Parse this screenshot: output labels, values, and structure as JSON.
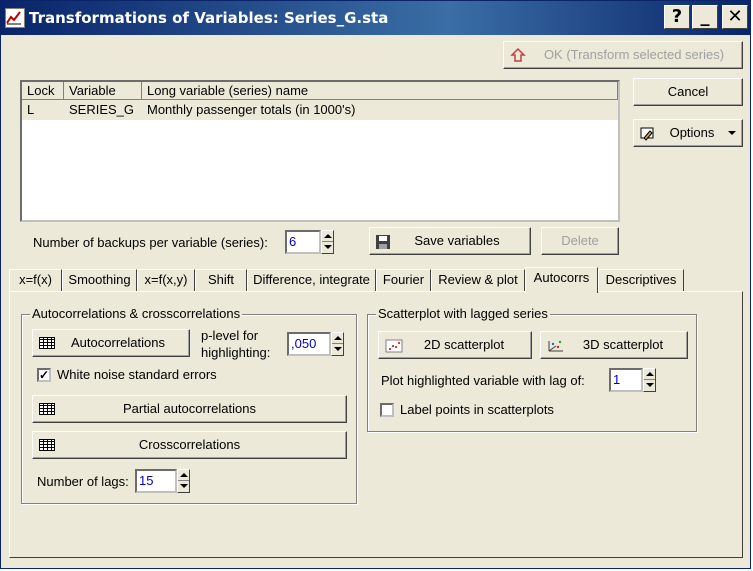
{
  "window": {
    "title": "Transformations of Variables: Series_G.sta",
    "help_glyph": "?",
    "minimize_glyph": "_",
    "close_glyph": "✕"
  },
  "toolbar": {
    "ok_label": "OK (Transform selected series)",
    "cancel_label": "Cancel",
    "options_label": "Options"
  },
  "list": {
    "headers": [
      "Lock",
      "Variable",
      "Long variable (series) name"
    ],
    "rows": [
      {
        "lock": "L",
        "variable": "SERIES_G",
        "name": "Monthly passenger totals (in 1000's)"
      }
    ]
  },
  "backups": {
    "label": "Number of backups per variable (series):",
    "value": "6",
    "save_label": "Save variables",
    "delete_label": "Delete"
  },
  "tabs": [
    {
      "label": "x=f(x)"
    },
    {
      "label": "Smoothing"
    },
    {
      "label": "x=f(x,y)"
    },
    {
      "label": "Shift"
    },
    {
      "label": "Difference, integrate"
    },
    {
      "label": "Fourier"
    },
    {
      "label": "Review & plot"
    },
    {
      "label": "Autocorrs",
      "active": true
    },
    {
      "label": "Descriptives"
    }
  ],
  "autocorr_group": {
    "title": "Autocorrelations & crosscorrelations",
    "autocorrelations_label": "Autocorrelations",
    "plevel_label_1": "p-level for",
    "plevel_label_2": "highlighting:",
    "plevel_value": ",050",
    "white_noise_label": "White noise standard errors",
    "white_noise_checked": true,
    "partial_label": "Partial autocorrelations",
    "cross_label": "Crosscorrelations",
    "lags_label": "Number of lags:",
    "lags_value": "15"
  },
  "scatter_group": {
    "title": "Scatterplot with lagged series",
    "scatter2d_label": "2D scatterplot",
    "scatter3d_label": "3D scatterplot",
    "lag_label": "Plot highlighted variable with lag of:",
    "lag_value": "1",
    "label_points_label": "Label points in scatterplots",
    "label_points_checked": false
  },
  "colors": {
    "titlebar": "#0a246a",
    "face": "#ece9d8",
    "value_text": "#0000c0"
  }
}
